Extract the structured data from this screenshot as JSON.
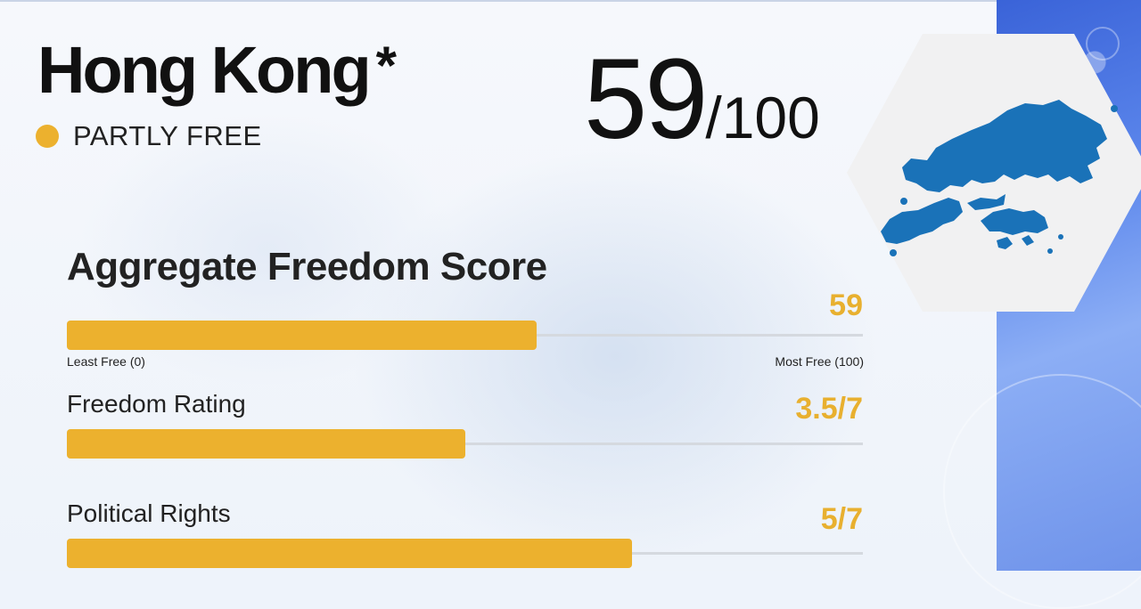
{
  "country": {
    "name": "Hong Kong",
    "marker": "*",
    "status": "PARTLY FREE",
    "status_color": "#ecb12e"
  },
  "overall_score": {
    "value": "59",
    "denominator": "/100"
  },
  "map": {
    "icon": "hong-kong-map-icon",
    "color": "#1a72b8"
  },
  "aggregate": {
    "title": "Aggregate Freedom Score",
    "value_label": "59",
    "fraction": 0.59,
    "min_label": "Least Free (0)",
    "max_label": "Most Free (100)"
  },
  "freedom_rating": {
    "label": "Freedom Rating",
    "value_label": "3.5/7",
    "fraction": 0.5
  },
  "political_rights": {
    "label": "Political Rights",
    "value_label": "5/7",
    "fraction": 0.71
  },
  "colors": {
    "accent": "#ecb12e",
    "value_text": "#e8b02f",
    "track": "#d5d9df"
  }
}
